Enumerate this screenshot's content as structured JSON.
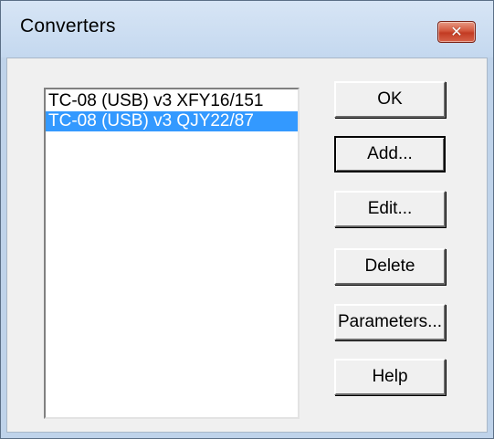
{
  "window": {
    "title": "Converters",
    "close_icon": "close-icon",
    "close_glyph": "✕"
  },
  "converters_list": {
    "items": [
      {
        "label": "TC-08 (USB) v3 XFY16/151",
        "selected": false
      },
      {
        "label": "TC-08 (USB) v3 QJY22/87",
        "selected": true
      }
    ]
  },
  "buttons": {
    "ok": "OK",
    "add": "Add...",
    "edit": "Edit...",
    "delete": "Delete",
    "parameters": "Parameters...",
    "help": "Help"
  },
  "colors": {
    "selection": "#3399ff",
    "close_button": "#c23b22"
  }
}
